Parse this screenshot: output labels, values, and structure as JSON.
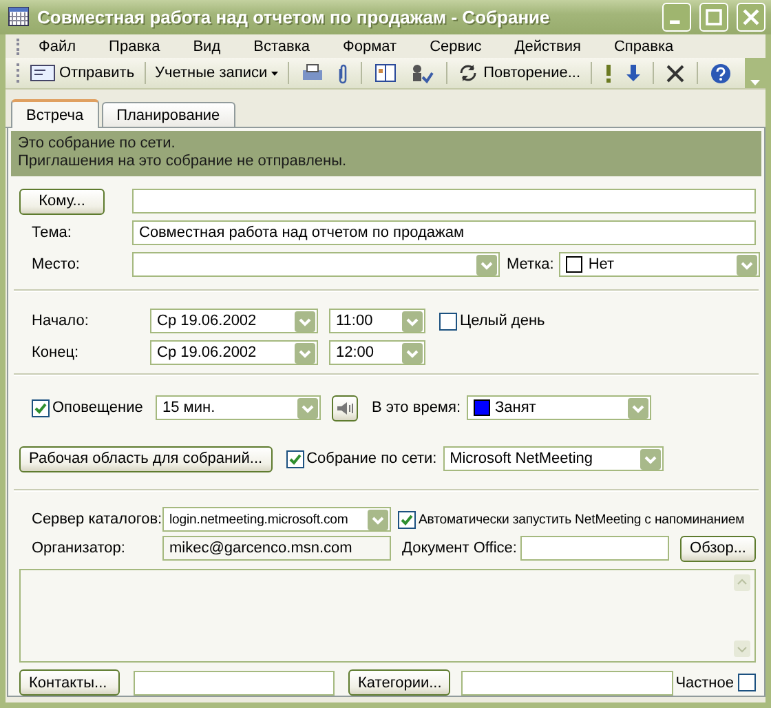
{
  "window": {
    "title": "Совместная работа над отчетом по продажам - Собрание"
  },
  "menu": [
    "Файл",
    "Правка",
    "Вид",
    "Вставка",
    "Формат",
    "Сервис",
    "Действия",
    "Справка"
  ],
  "toolbar": {
    "send": "Отправить",
    "accounts": "Учетные записи",
    "recurrence": "Повторение..."
  },
  "tabs": [
    {
      "label": "Встреча",
      "selected": true
    },
    {
      "label": "Планирование",
      "selected": false
    }
  ],
  "info": [
    "Это собрание по сети.",
    "Приглашения на это собрание не отправлены."
  ],
  "to": {
    "button": "Кому..."
  },
  "subject": {
    "label": "Тема:",
    "value": "Совместная работа над отчетом по продажам"
  },
  "location": {
    "label": "Место:"
  },
  "tag": {
    "label": "Метка:",
    "value": "Нет",
    "color": "#ffffff"
  },
  "start": {
    "label": "Начало:",
    "date": "Ср 19.06.2002",
    "time": "11:00"
  },
  "end": {
    "label": "Конец:",
    "date": "Ср 19.06.2002",
    "time": "12:00"
  },
  "all_day": {
    "label": "Целый день",
    "checked": false
  },
  "reminder": {
    "label": "Оповещение",
    "checked": true,
    "value": "15 мин."
  },
  "show_as": {
    "label": "В это время:",
    "value": "Занят",
    "color": "#0000ff"
  },
  "workspace": {
    "button": "Рабочая область для собраний..."
  },
  "online": {
    "label": "Собрание по сети:",
    "checked": true,
    "value": "Microsoft NetMeeting"
  },
  "server": {
    "label": "Сервер каталогов:",
    "value": "login.netmeeting.microsoft.com"
  },
  "auto_start": {
    "label": "Автоматически запустить NetMeeting с напоминанием",
    "checked": true
  },
  "organizer": {
    "label": "Организатор:",
    "value": "mikec@garcenco.msn.com"
  },
  "office_doc": {
    "label": "Документ Office:",
    "button": "Обзор..."
  },
  "contacts": {
    "button": "Контакты..."
  },
  "categories": {
    "button": "Категории..."
  },
  "private": {
    "label": "Частное",
    "checked": false
  }
}
